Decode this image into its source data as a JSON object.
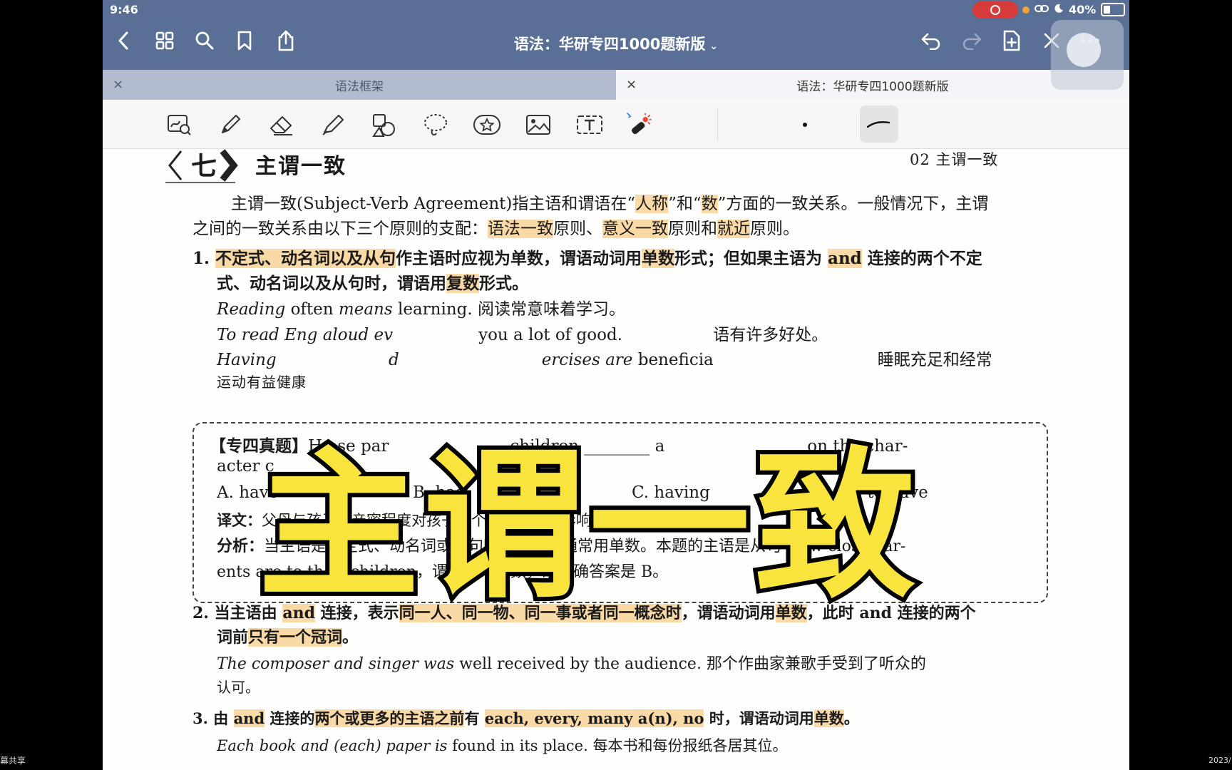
{
  "status_bar": {
    "time": "9:46",
    "battery": "40%"
  },
  "nav": {
    "document_title": "语法：华研专四1000题新版",
    "title_chevron": "⌄"
  },
  "tabs": [
    {
      "label": "语法框架",
      "close": "×"
    },
    {
      "label": "语法：华研专四1000题新版",
      "close": "×"
    }
  ],
  "page": {
    "section_number": "七",
    "section_title": "主谓一致",
    "header_right": "02  主谓一致",
    "intro": {
      "l1_a": "主谓一致(Subject-Verb Agreement)指主语和谓语在“",
      "l1_hl1": "人称",
      "l1_b": "”和“",
      "l1_hl2": "数",
      "l1_c": "”方面的一致关系。一般情况下，主谓",
      "l2_a": "之间的一致关系由以下三个原则的支配：",
      "l2_hl1": "语法一致",
      "l2_b": "原则、",
      "l2_hl2": "意义一致",
      "l2_c": "原则和",
      "l2_hl3": "就近",
      "l2_d": "原则。"
    },
    "rule1": {
      "num": "1.",
      "hl1": "不定式、动名词以及从句",
      "a": "作主语时应视为单数，谓语动词用",
      "hl2": "单数",
      "b": "形式；但如果主语为 ",
      "hl3": "and",
      "c": " 连接的两个不定",
      "l2_a": "式、动名词以及从句时，谓语用",
      "l2_hl": "复数",
      "l2_b": "形式。",
      "ex1_it1": "Reading",
      "ex1_a": " often ",
      "ex1_it2": "means",
      "ex1_b": " learning.  阅读常意味着学习。",
      "ex2_it": "To read Eng",
      "ex2_a": "   aloud  ev",
      "ex2_b": "you  a  lot  of  good.  ",
      "ex2_c": "语有许多好处。",
      "ex3_it": "Having",
      "ex3_a": "   d",
      "ex3_it2": "ercises  are",
      "ex3_b": "  beneficia",
      "ex3_c": "睡眠充足和经常",
      "ex3_l2": "运动有益健康"
    },
    "quiz": {
      "tag": "【专四真题】",
      "q_a": "H      ose  par",
      "q_b": "children",
      "q_blank": "________",
      "q_c": "a",
      "q_d": "on  the  char-",
      "q_l2": "acter  c",
      "opt_a": "A.  have",
      "opt_b": "B.  has",
      "opt_c": "C.  having",
      "opt_d": "D.  to  have",
      "trans_label": "译文：",
      "trans": "父母与孩子的亲密程度对孩子的个性有很大的影响。",
      "anal_label": "分析：",
      "anal1": "当主语是不定式、动名词或从句时谓语动词通常用单数。本题的主语是从句 How close par-",
      "anal2": "ents  are  to  their  children，谓语应为单数，故正确答案是 B。"
    },
    "rule2": {
      "num": "2.",
      "a": "当主语由 ",
      "hl1": "and",
      "b": " 连接，表示",
      "hl2": "同一人、同一物、同一事或者同一概念时",
      "c": "，谓语动词用",
      "hl3": "单数",
      "d": "，此时 and 连接的两个",
      "l2_a": "词前",
      "l2_hl": "只有一个冠词",
      "l2_b": "。",
      "ex_it1": "The  composer  and  singer  was",
      "ex_a": "  well  received  by  the  audience.  那个作曲家兼歌手受到了听众的",
      "ex_l2": "认可。"
    },
    "rule3": {
      "num": "3.",
      "a": "由 ",
      "hl1": "and",
      "b": " 连接的",
      "hl2": "两个或更多的主语之前",
      "c": "有 ",
      "hl3": "each,  every,  many  a(n),  no",
      "d": " 时，谓语动词用",
      "hl4": "单数",
      "e": "。",
      "ex_it": "Each  book  and  (each)  paper  is",
      "ex_a": "  found  in  its  place.  每本书和每份报纸各居其位。"
    }
  },
  "overlay_title": "主谓一致",
  "side_labels": {
    "left": "幕共享",
    "right": "2023/"
  }
}
